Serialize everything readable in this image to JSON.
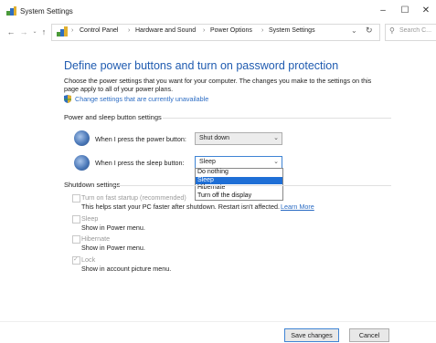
{
  "window": {
    "title": "System Settings",
    "minimize_glyph": "–",
    "maximize_glyph": "☐",
    "close_glyph": "✕"
  },
  "nav": {
    "back_glyph": "←",
    "forward_glyph": "→",
    "recent_glyph": "⌄",
    "up_glyph": "↑",
    "breadcrumbs": [
      "Control Panel",
      "Hardware and Sound",
      "Power Options",
      "System Settings"
    ],
    "separator": "›",
    "dropdown_glyph": "⌄",
    "refresh_glyph": "↻",
    "search_glyph": "⚲",
    "search_placeholder": "Search C..."
  },
  "main": {
    "title": "Define power buttons and turn on password protection",
    "description": "Choose the power settings that you want for your computer. The changes you make to the settings on this page apply to all of your power plans.",
    "change_settings_link": "Change settings that are currently unavailable"
  },
  "power_sleep": {
    "header": "Power and sleep button settings",
    "power_button": {
      "label": "When I press the power button:",
      "value": "Shut down"
    },
    "sleep_button": {
      "label": "When I press the sleep button:",
      "value": "Sleep",
      "options": [
        "Do nothing",
        "Sleep",
        "Hibernate",
        "Turn off the display"
      ],
      "highlighted": "Sleep"
    },
    "arrow_glyph": "⌄"
  },
  "shutdown": {
    "header": "Shutdown settings",
    "fast_startup": {
      "label": "Turn on fast startup (recommended)",
      "desc": "This helps start your PC faster after shutdown. Restart isn't affected.",
      "link": "Learn More",
      "checked": false
    },
    "sleep": {
      "label": "Sleep",
      "desc": "Show in Power menu.",
      "checked": false
    },
    "hibernate": {
      "label": "Hibernate",
      "desc": "Show in Power menu.",
      "checked": false
    },
    "lock": {
      "label": "Lock",
      "desc": "Show in account picture menu.",
      "checked": true
    }
  },
  "footer": {
    "save_label": "Save changes",
    "cancel_label": "Cancel"
  },
  "colors": {
    "title_blue": "#1f5bb0",
    "link_blue": "#2b6cc4",
    "selection_blue": "#1f6fd6"
  },
  "icons": {
    "app": "power-options-icon",
    "shield": "uac-shield-icon",
    "power_button": "power-button-icon",
    "sleep_button": "sleep-button-icon"
  }
}
